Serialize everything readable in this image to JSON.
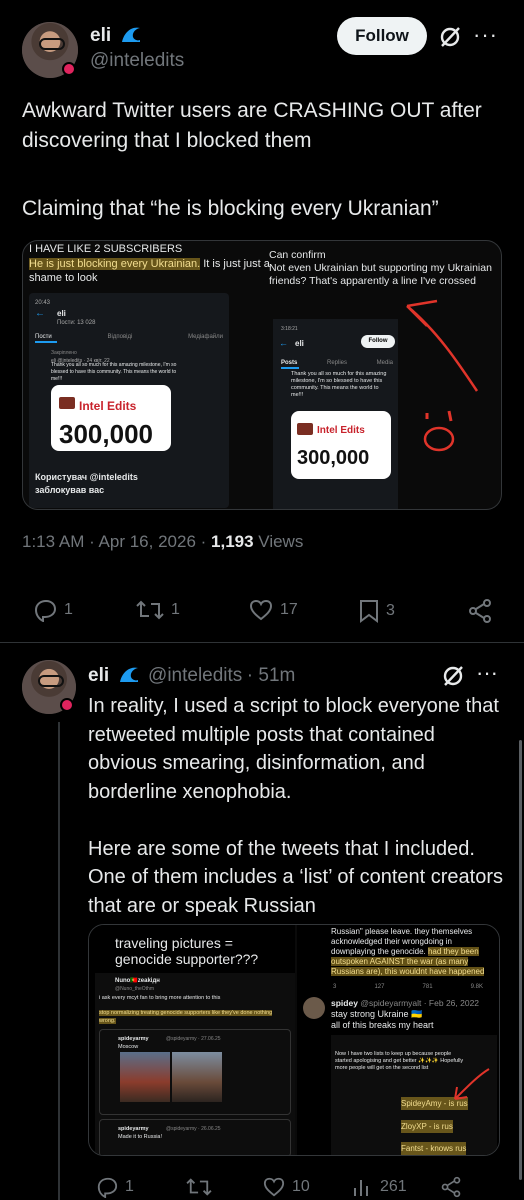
{
  "post": {
    "author_name": "eli",
    "author_handle": "@inteledits",
    "follow_label": "Follow",
    "text_line1": "Awkward Twitter users are CRASHING OUT after discovering that I blocked them",
    "text_line2": "Claiming that “he is blocking every Ukranian”",
    "timestamp": "1:13 AM · Apr 16, 2026 · ",
    "views_count": "1,193",
    "views_label": " Views",
    "replies": "1",
    "reposts": "1",
    "likes": "17",
    "bookmarks": "3"
  },
  "media1": {
    "left_header": "I HAVE LIKE 2 SUBSCRIBERS",
    "left_highlight": "He is just blocking every Ukrainian.",
    "left_rest": " It is just just a shame to look",
    "left_status_time": "20:43",
    "left_profile_name": "eli",
    "left_posts_count": "Пости: 13 028",
    "left_tabs": [
      "Пости",
      "Відповіді",
      "Медіафайли"
    ],
    "left_pinned": "Закріплено",
    "left_tweet_meta": "eli @inteledits · 24 квіт. 22",
    "left_tweet_text": "Thank you all so much for this amazing milestone, I'm so blessed to have this community. This means the world to me!!!",
    "card_title": "Intel Edits",
    "card_number": "300,000",
    "left_blocked_line1": "Користувач @inteledits",
    "left_blocked_line2": "заблокував вас",
    "right_text": "Can confirm\nNot even Ukrainian but supporting my Ukrainian friends? That's apparently a line I've crossed",
    "right_status_time": "3:18:21",
    "right_profile_name": "eli",
    "right_follow": "Follow",
    "right_tabs": [
      "Posts",
      "Replies",
      "Media"
    ],
    "right_tweet_text": "Thank you all so much for this amazing milestone, I'm so blessed to have this community. This means the world to me!!!"
  },
  "reply": {
    "author_name": "eli",
    "author_handle": "@inteledits",
    "time": "· 51m",
    "text": "In reality, I used a script to block everyone that retweeted multiple posts that contained obvious smearing, disinformation, and borderline xenophobia.\n\nHere are some of the tweets that I included. One of them includes a ‘list’ of content creators that are or speak Russian",
    "replies": "1",
    "reposts": "",
    "likes": "10",
    "views": "261"
  },
  "media2": {
    "left_caption": "traveling pictures = genocide supporter???",
    "tweet1_name": "Nuno🇵🇹zeakiдн",
    "tweet1_handle": "@Nuno_theOthm",
    "tweet1_text": "i ask every mcyt fan to bring more attention to this",
    "tweet1_highlight": "stop normalizing treating genocide supporters like they've done nothing wrong.",
    "tweet2_name": "spideyarmy",
    "tweet2_meta": "@spideyarmy · 27.06.25",
    "tweet2_text": "Moscow",
    "tweet3_name": "spideyarmy",
    "tweet3_meta": "@spideyarmy · 26.06.25",
    "tweet3_text": "Made it to Russia!",
    "right_top_text": "Russian\" please leave. they themselves acknowledged their wrongdoing in downplaying the genocide.",
    "right_top_highlight": "had they been outspoken AGAINST the war (as many Russians are), this wouldnt have happened",
    "right_stats": [
      "3",
      "127",
      "781",
      "9.8K"
    ],
    "right_tweet_name": "spidey",
    "right_tweet_meta": "@spideyarmyalt · Feb 26, 2022",
    "right_tweet_text": "stay strong Ukraine 🇺🇦\nall of this breaks my heart",
    "right_list_intro": "Now I have two lists to keep up because people started apologising and get better ✨✨✨ Hopefully more people will get on the second list",
    "list_items": [
      "SpideyAmy - is rus",
      "ZloyXP - is rus",
      "Fantst - knows rus"
    ]
  },
  "colors": {
    "background": "#000000",
    "text": "#e7e9ea",
    "secondary": "#71767b",
    "accent_blue": "#1d9bf0",
    "highlight": "#b59428",
    "red_annotation": "#e0342a"
  },
  "icons": [
    "wave-icon",
    "grok-icon",
    "more-icon",
    "reply-icon",
    "repost-icon",
    "like-icon",
    "bookmark-icon",
    "share-icon"
  ]
}
